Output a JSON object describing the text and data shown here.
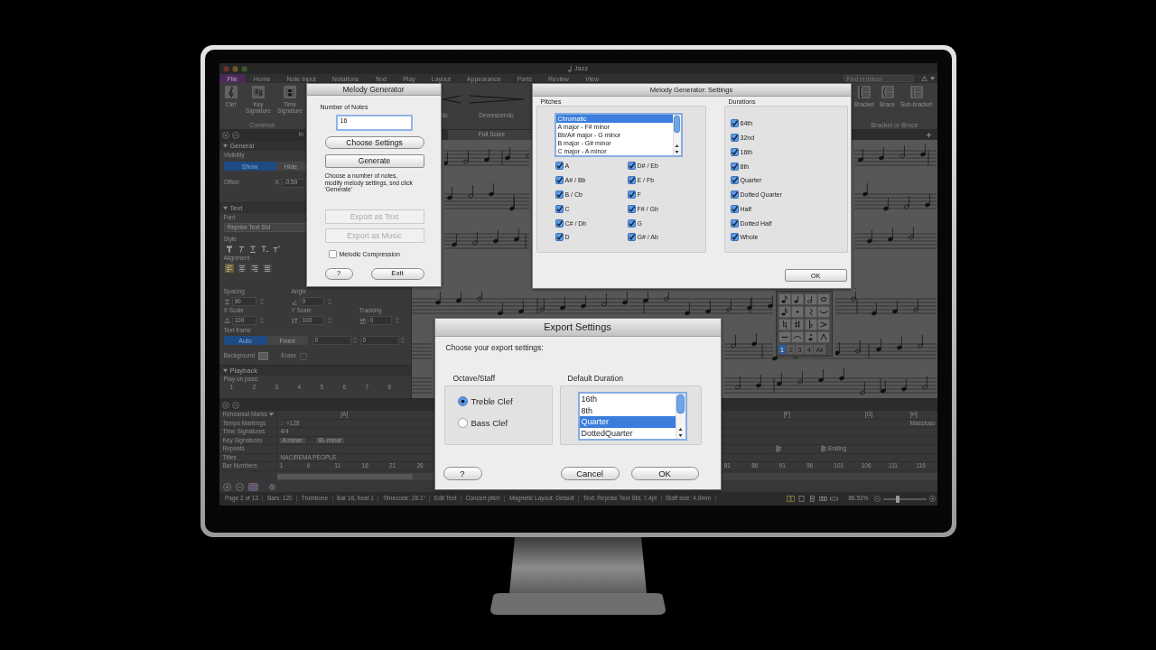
{
  "app": {
    "window_title": "Jazz",
    "ribbon_tabs": [
      {
        "label": "File",
        "selected": true
      },
      {
        "label": "Home",
        "selected": false
      },
      {
        "label": "Note Input",
        "selected": false
      },
      {
        "label": "Notations",
        "selected": false
      },
      {
        "label": "Text",
        "selected": false
      },
      {
        "label": "Play",
        "selected": false
      },
      {
        "label": "Layout",
        "selected": false
      },
      {
        "label": "Appearance",
        "selected": false
      },
      {
        "label": "Parts",
        "selected": false
      },
      {
        "label": "Review",
        "selected": false
      },
      {
        "label": "View",
        "selected": false
      }
    ],
    "ribbon_search": {
      "placeholder": "Find in ribbon"
    },
    "ribbon_groups": [
      {
        "label": "Common",
        "tools": [
          {
            "label": "Clef",
            "kind": "clef"
          },
          {
            "label": "Key Signature",
            "kind": "key"
          },
          {
            "label": "Time Signature",
            "kind": "time"
          }
        ]
      },
      {
        "tools": [
          {
            "label": "do",
            "kind": "crescendo"
          },
          {
            "label": "Decrescendo",
            "kind": "decrescendo"
          }
        ]
      },
      {
        "label": "Bracket or Brace",
        "tools": [
          {
            "label": "Bracket",
            "kind": "bracket"
          },
          {
            "label": "Brace",
            "kind": "brace"
          },
          {
            "label": "Sub-bracket",
            "kind": "subbracket"
          }
        ]
      }
    ],
    "document_tabs": [
      {
        "label": "Full Score",
        "selected": true
      }
    ],
    "inspector": {
      "title": "In",
      "general": {
        "heading": "General",
        "expanded": true,
        "visibility_label": "Visibility",
        "visibility": [
          {
            "label": "Show",
            "selected": true
          },
          {
            "label": "Hide",
            "selected": false
          }
        ],
        "offset_label": "Offset",
        "offset_axis": "X",
        "offset_value": "-0.59"
      },
      "text": {
        "heading": "Text",
        "expanded": true,
        "font_label": "Font",
        "font": "Reprise Text Std",
        "style_label": "Style",
        "alignment_label": "Alignment",
        "alignment": [
          {
            "selected": true
          },
          {
            "selected": false
          },
          {
            "selected": false
          },
          {
            "selected": false
          }
        ],
        "spacing_label": "Spacing",
        "spacing": "90",
        "angle_label": "Angle",
        "angle": "0",
        "x_scale_label": "X Scale",
        "x_scale": "100",
        "y_scale_label": "Y Scale",
        "y_scale": "100",
        "tracking_label": "Tracking",
        "tracking": "0",
        "frame_label": "Text frame",
        "frame": [
          {
            "label": "Auto",
            "selected": true
          },
          {
            "label": "Fixed",
            "selected": false
          }
        ],
        "frame_values": [
          "0",
          "0"
        ],
        "background_label": "Background",
        "erase": {
          "label": "Erase",
          "checked": false
        }
      },
      "playback": {
        "heading": "Playback",
        "expanded": true,
        "passes_label": "Play on pass:",
        "passes": [
          "1",
          "2",
          "3",
          "4",
          "5",
          "6",
          "7",
          "8"
        ]
      }
    },
    "keypad": {
      "tabs": [
        {
          "label": "1",
          "selected": true
        },
        {
          "label": "2",
          "selected": false
        },
        {
          "label": "3",
          "selected": false
        },
        {
          "label": "4",
          "selected": false
        },
        {
          "label": "All",
          "selected": false
        }
      ]
    },
    "timeline": {
      "rows": [
        {
          "label": "Rehearsal Marks",
          "kind": "marks",
          "left": [
            {
              "text": "[A]"
            }
          ],
          "right": [
            {
              "text": "[F]"
            },
            {
              "text": "[G]"
            },
            {
              "text": "[H]"
            }
          ]
        },
        {
          "label": "Tempo Markings",
          "kind": "tempo",
          "left": [
            {
              "text": "♩=128"
            }
          ],
          "right": [
            {
              "text": "Maestoso"
            }
          ]
        },
        {
          "label": "Time Signatures",
          "kind": "time",
          "left": [
            {
              "text": "4/4"
            }
          ]
        },
        {
          "label": "Key Signatures",
          "kind": "key",
          "left": [
            {
              "text": "A minor"
            },
            {
              "text": "B♭ minor"
            }
          ]
        },
        {
          "label": "Repeats",
          "kind": "repeats",
          "right": [
            {
              "kind": "repeat"
            },
            {
              "kind": "ending",
              "text": "Ending"
            }
          ]
        },
        {
          "label": "Titles",
          "kind": "title",
          "left": [
            {
              "text": "NACIREMA PEOPLE"
            }
          ]
        },
        {
          "label": "Bar Numbers",
          "kind": "numbers",
          "left": [
            {
              "text": "1"
            },
            {
              "text": "6"
            },
            {
              "text": "11"
            },
            {
              "text": "16"
            },
            {
              "text": "21"
            },
            {
              "text": "26"
            }
          ],
          "right": [
            {
              "text": "81"
            },
            {
              "text": "86"
            },
            {
              "text": "91"
            },
            {
              "text": "96"
            },
            {
              "text": "101"
            },
            {
              "text": "106"
            },
            {
              "text": "111"
            },
            {
              "text": "116"
            }
          ]
        }
      ]
    },
    "status_bar": {
      "items": [
        "Page 2 of 13",
        "Bars: 120",
        "Trombone",
        "Bar 16, beat 1",
        "Timecode: 28.1\"",
        "Edit Text",
        "Concert pitch",
        "Magnetic Layout: Default",
        "Text: Reprise Text Std, 7.4pt",
        "Staff size: 4.0mm"
      ],
      "zoom": "86.53%",
      "zoom_slider": {
        "level": 0.35
      }
    }
  },
  "melody_generator": {
    "title": "Melody Generator",
    "notes_label": "Number of Notes",
    "notes_field": {
      "value": "16"
    },
    "buttons": [
      {
        "label": "Choose Settings",
        "kind": "pill",
        "disabled": false
      },
      {
        "label": "Generate",
        "kind": "square",
        "disabled": false
      }
    ],
    "help_text": "Choose a number of notes,\nmodify melody settings, snd click\n'Generate'",
    "export_buttons": [
      {
        "label": "Export as Text",
        "disabled": true
      },
      {
        "label": "Export as Music",
        "disabled": true
      }
    ],
    "compression": {
      "label": "Melodic Compression",
      "checked": false
    },
    "footer_buttons": [
      {
        "label": "?"
      },
      {
        "label": "Exit"
      }
    ]
  },
  "settings": {
    "title": "Melody Generator: Settings",
    "pitches": {
      "label": "Pitches",
      "scales": [
        {
          "label": "Chromatic",
          "selected": true
        },
        {
          "label": "A major - F# minor",
          "selected": false
        },
        {
          "label": "Bb/A# major - G minor",
          "selected": false
        },
        {
          "label": "B major - G# minor",
          "selected": false
        },
        {
          "label": "C major - A minor",
          "selected": false
        }
      ],
      "notes": [
        {
          "label": "A",
          "checked": true
        },
        {
          "label": "A# / Bb",
          "checked": true
        },
        {
          "label": "B / Cb",
          "checked": true
        },
        {
          "label": "C",
          "checked": true
        },
        {
          "label": "C# / Db",
          "checked": true
        },
        {
          "label": "D",
          "checked": true
        },
        {
          "label": "D# / Eb",
          "checked": true
        },
        {
          "label": "E / Fb",
          "checked": true
        },
        {
          "label": "F",
          "checked": true
        },
        {
          "label": "F# / Gb",
          "checked": true
        },
        {
          "label": "G",
          "checked": true
        },
        {
          "label": "G# / Ab",
          "checked": true
        }
      ]
    },
    "durations": {
      "label": "Durations",
      "items": [
        {
          "label": "64th",
          "checked": true
        },
        {
          "label": "32nd",
          "checked": true
        },
        {
          "label": "16th",
          "checked": true
        },
        {
          "label": "8th",
          "checked": true
        },
        {
          "label": "Quarter",
          "checked": true
        },
        {
          "label": "Dotted Quarter",
          "checked": true
        },
        {
          "label": "Half",
          "checked": true
        },
        {
          "label": "Dotted Half",
          "checked": true
        },
        {
          "label": "Whole",
          "checked": true
        }
      ]
    },
    "ok": "OK"
  },
  "export_settings": {
    "title": "Export Settings",
    "prompt": "Choose your export settings:",
    "octave": {
      "label": "Octave/Staff",
      "options": [
        {
          "label": "Treble Clef",
          "selected": true
        },
        {
          "label": "Bass Clef",
          "selected": false
        }
      ]
    },
    "duration": {
      "label": "Default Duration",
      "options": [
        {
          "label": "16th",
          "selected": false
        },
        {
          "label": "8th",
          "selected": false
        },
        {
          "label": "Quarter",
          "selected": true
        },
        {
          "label": "DottedQuarter",
          "selected": false
        }
      ]
    },
    "buttons": [
      {
        "label": "?",
        "kind": "help"
      },
      {
        "label": "Cancel",
        "kind": "cancel"
      },
      {
        "label": "OK",
        "kind": "default"
      }
    ]
  }
}
